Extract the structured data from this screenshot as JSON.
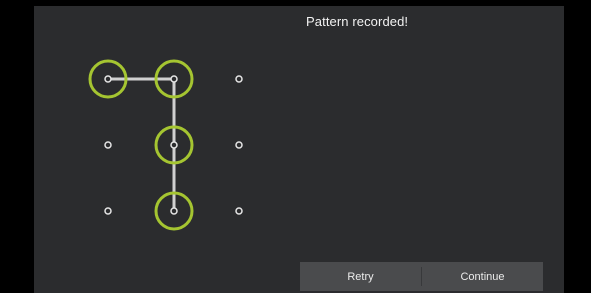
{
  "status_text": "Pattern recorded!",
  "buttons": {
    "retry_label": "Retry",
    "continue_label": "Continue"
  },
  "pattern": {
    "grid": "3x3",
    "selected_sequence": [
      "r0c0",
      "r0c1",
      "r1c1",
      "r2c1"
    ],
    "accent_color": "#a5c531",
    "path_color": "#d0d0d0"
  }
}
